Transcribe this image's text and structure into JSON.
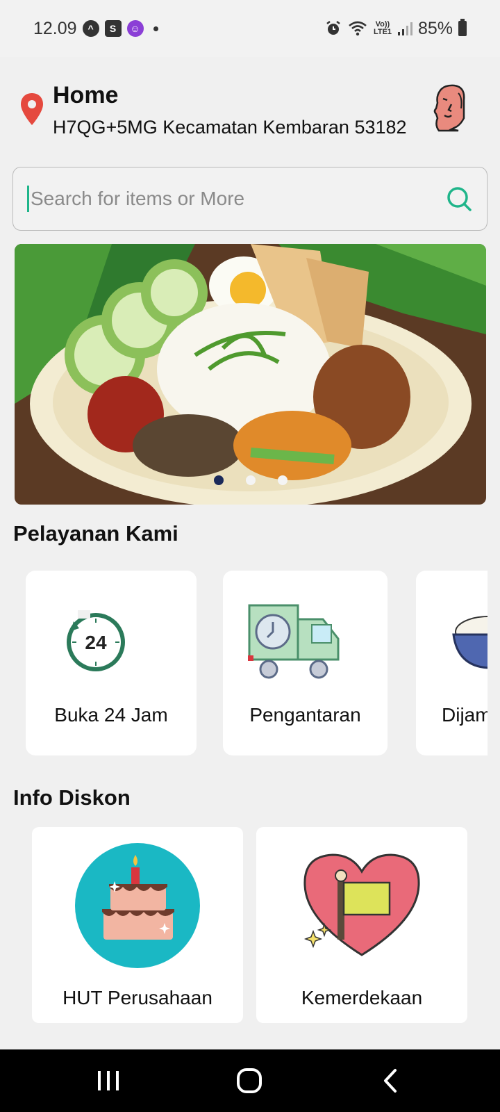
{
  "status_bar": {
    "time": "12.09",
    "battery": "85%",
    "network_label": "Vo)) LTE1"
  },
  "header": {
    "title": "Home",
    "address": "H7QG+5MG Kecamatan Kembaran 53182"
  },
  "search": {
    "placeholder": "Search for items or More"
  },
  "banner": {
    "slide_count": 3,
    "active_slide": 1
  },
  "services": {
    "title": "Pelayanan Kami",
    "items": [
      {
        "label": "Buka 24 Jam",
        "icon": "clock-24-icon"
      },
      {
        "label": "Pengantaran",
        "icon": "delivery-truck-icon"
      },
      {
        "label": "Dijamin",
        "icon": "rice-bowl-icon"
      }
    ],
    "clock_text": "24"
  },
  "discounts": {
    "title": "Info Diskon",
    "items": [
      {
        "label": "HUT Perusahaan",
        "icon": "birthday-cake-icon"
      },
      {
        "label": "Kemerdekaan",
        "icon": "heart-flag-icon"
      }
    ]
  },
  "colors": {
    "accent_green": "#1fb58a",
    "pin_red": "#e5493e",
    "cake_bg": "#1ab8c4",
    "heart": "#e96a79"
  }
}
